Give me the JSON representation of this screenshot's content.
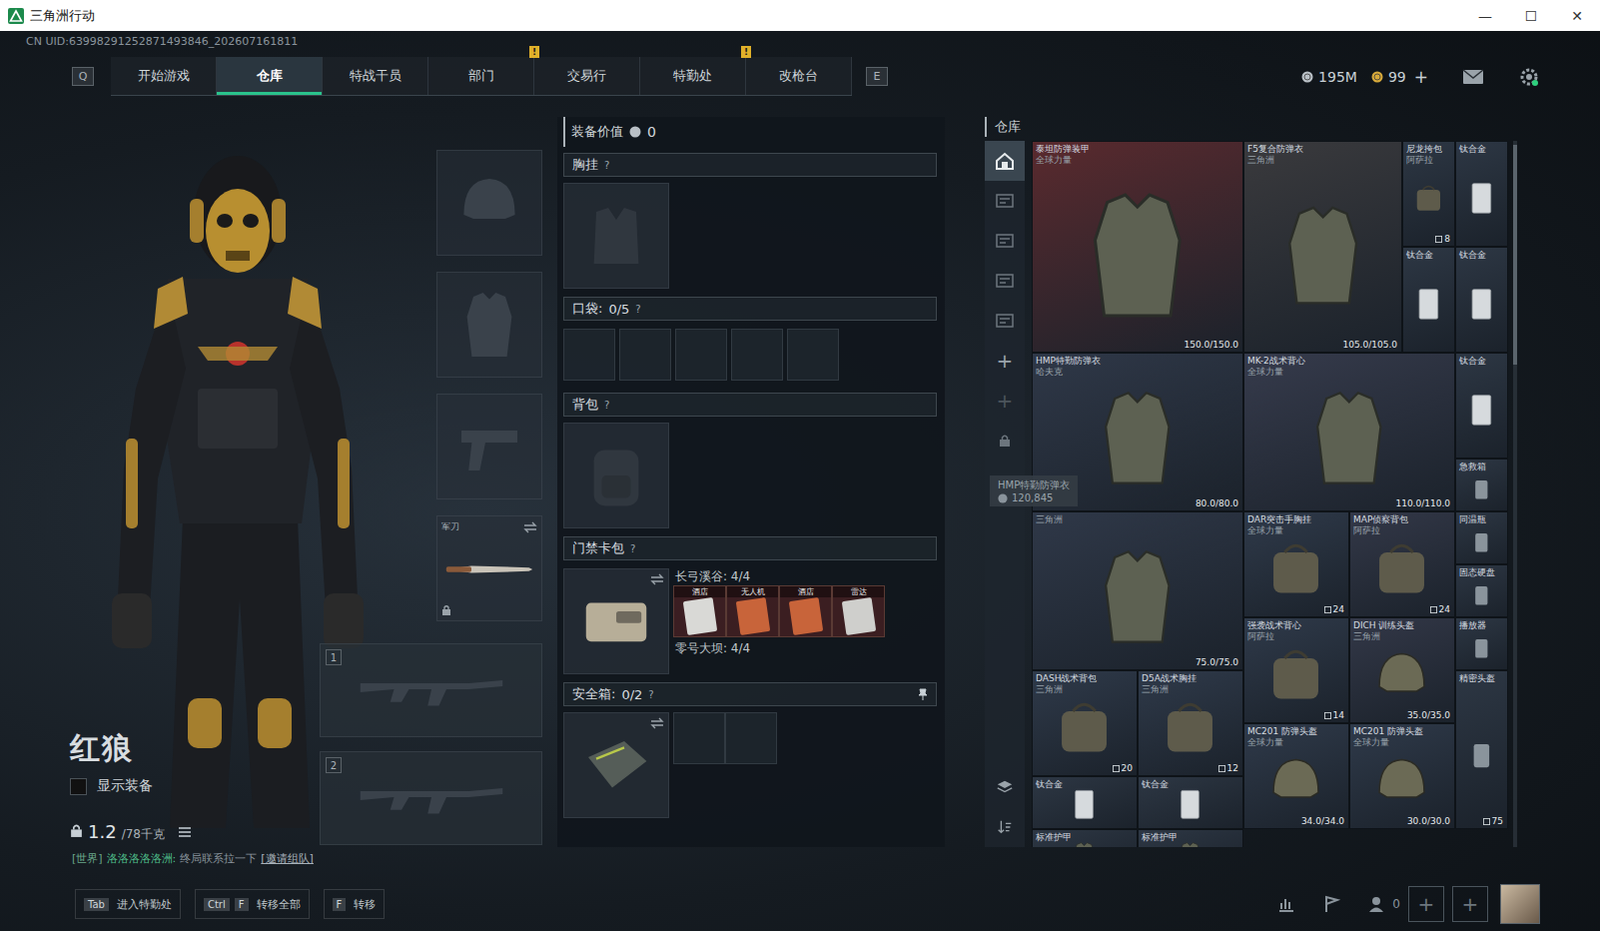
{
  "window": {
    "title": "三角洲行动",
    "controls": [
      "—",
      "☐",
      "✕"
    ]
  },
  "uid": "CN UID:63998291252871493846_202607161811",
  "nav": {
    "left_key": "Q",
    "right_key": "E",
    "alert_glyph": "!",
    "tabs": [
      {
        "label": "开始游戏",
        "selected": false,
        "alert": false
      },
      {
        "label": "仓库",
        "selected": true,
        "alert": false
      },
      {
        "label": "特战干员",
        "selected": false,
        "alert": false
      },
      {
        "label": "部门",
        "selected": false,
        "alert": false
      },
      {
        "label": "交易行",
        "selected": false,
        "alert": true
      },
      {
        "label": "特勤处",
        "selected": false,
        "alert": false
      },
      {
        "label": "改枪台",
        "selected": false,
        "alert": true
      }
    ]
  },
  "currency": {
    "items": [
      {
        "amount": "195M",
        "kind": "silver"
      },
      {
        "amount": "99",
        "kind": "gold"
      }
    ],
    "add": "+"
  },
  "character": {
    "name": "红狼",
    "show_gear": {
      "label": "显示装备",
      "checked": false
    },
    "weight": "1.2",
    "weight_max": "/78千克"
  },
  "chat": {
    "channel": "[世界]",
    "sender": "洛洛洛洛洛洲:",
    "message": "终局联系拉一下",
    "link": "[邀请组队]"
  },
  "slots": {
    "melee_label": "军刀",
    "weapon_slots": [
      "1",
      "2"
    ]
  },
  "loadout": {
    "value_label": "装备价值",
    "value": "0",
    "help": "?",
    "chest": {
      "label": "胸挂"
    },
    "pocket": {
      "label": "口袋:",
      "count": "0/5",
      "slots": 5
    },
    "backpack": {
      "label": "背包"
    },
    "keycard": {
      "label": "门禁卡包",
      "maps": [
        {
          "name": "长弓溪谷: 4/4",
          "cards": [
            {
              "label": "酒店",
              "color": "#d9d9d6"
            },
            {
              "label": "无人机",
              "color": "#c8643a"
            },
            {
              "label": "酒店",
              "color": "#c8643a"
            },
            {
              "label": "雷达",
              "color": "#cfcfcc"
            }
          ]
        },
        {
          "name": "零号大坝: 4/4",
          "cards": []
        }
      ]
    },
    "safebox": {
      "label": "安全箱:",
      "count": "0/2",
      "slots": 2
    }
  },
  "warehouse": {
    "title": "仓库",
    "sidebar": {
      "tabs": [
        {
          "selected": true
        },
        {
          "selected": false
        },
        {
          "selected": false
        },
        {
          "selected": false
        },
        {
          "selected": false
        }
      ],
      "add": [
        {
          "glyph": "+",
          "disabled": false
        },
        {
          "glyph": "+",
          "disabled": true
        }
      ]
    },
    "tooltip": {
      "name": "HMP特勤防弹衣",
      "value": "120,845"
    },
    "items": [
      {
        "name": "泰坦防弹装甲",
        "brand": "全球力量",
        "kind": "armor",
        "stat": "150.0/150.0",
        "count": "",
        "color": "#5a2a2e"
      },
      {
        "name": "F5复合防弹衣",
        "brand": "三角洲",
        "kind": "armor",
        "stat": "105.0/105.0",
        "count": "",
        "color": "#3a3a3d"
      },
      {
        "name": "尼龙挎包",
        "brand": "阿萨拉",
        "kind": "bag",
        "stat": "",
        "count": "8",
        "color": "#2d3744"
      },
      {
        "name": "钛合金",
        "brand": "",
        "kind": "plate",
        "stat": "",
        "count": "",
        "color": "#2d3744"
      },
      {
        "name": "钛合金",
        "brand": "",
        "kind": "plate",
        "stat": "",
        "count": "",
        "color": "#2d3744"
      },
      {
        "name": "钛合金",
        "brand": "",
        "kind": "plate",
        "stat": "",
        "count": "",
        "color": "#2d3744"
      },
      {
        "name": "HMP特勤防弹衣",
        "brand": "哈夫克",
        "kind": "armor",
        "stat": "80.0/80.0",
        "count": "",
        "color": "#2f3848"
      },
      {
        "name": "MK-2战术背心",
        "brand": "全球力量",
        "kind": "armor",
        "stat": "110.0/110.0",
        "count": "",
        "color": "#363b4c"
      },
      {
        "name": "钛合金",
        "brand": "",
        "kind": "plate",
        "stat": "",
        "count": "",
        "color": "#2d3744"
      },
      {
        "name": "急救箱",
        "brand": "",
        "kind": "misc",
        "stat": "",
        "count": "",
        "color": "#2d3744"
      },
      {
        "name": "",
        "brand": "三角洲",
        "kind": "armor",
        "stat": "75.0/75.0",
        "count": "",
        "color": "#2f3848"
      },
      {
        "name": "DAR突击手胸挂",
        "brand": "全球力量",
        "kind": "bag",
        "stat": "",
        "count": "24",
        "color": "#2f3a4a"
      },
      {
        "name": "MAP侦察背包",
        "brand": "阿萨拉",
        "kind": "bag",
        "stat": "",
        "count": "24",
        "color": "#333848"
      },
      {
        "name": "同温瓶",
        "brand": "",
        "kind": "misc",
        "stat": "",
        "count": "",
        "color": "#2d3744"
      },
      {
        "name": "固态硬盘",
        "brand": "",
        "kind": "misc",
        "stat": "",
        "count": "",
        "color": "#2d3744"
      },
      {
        "name": "强袭战术背心",
        "brand": "阿萨拉",
        "kind": "bag",
        "stat": "",
        "count": "14",
        "color": "#2f3a4a"
      },
      {
        "name": "DICH 训练头盔",
        "brand": "三角洲",
        "kind": "helmet",
        "stat": "35.0/35.0",
        "count": "",
        "color": "#333848"
      },
      {
        "name": "播放器",
        "brand": "",
        "kind": "misc",
        "stat": "",
        "count": "",
        "color": "#2d3744"
      },
      {
        "name": "DASH战术背包",
        "brand": "三角洲",
        "kind": "bag",
        "stat": "",
        "count": "20",
        "color": "#2f3a4a"
      },
      {
        "name": "D5A战术胸挂",
        "brand": "三角洲",
        "kind": "bag",
        "stat": "",
        "count": "12",
        "color": "#2f3a4a"
      },
      {
        "name": "精密头盔",
        "brand": "",
        "kind": "misc",
        "stat": "",
        "count": "75",
        "color": "#2d3744"
      },
      {
        "name": "MC201 防弹头盔",
        "brand": "全球力量",
        "kind": "helmet",
        "stat": "34.0/34.0",
        "count": "",
        "color": "#2f3a4a"
      },
      {
        "name": "MC201 防弹头盔",
        "brand": "全球力量",
        "kind": "helmet",
        "stat": "30.0/30.0",
        "count": "",
        "color": "#2f3a4a"
      },
      {
        "name": "钛合金",
        "brand": "",
        "kind": "plate",
        "stat": "",
        "count": "",
        "color": "#2d3744"
      },
      {
        "name": "钛合金",
        "brand": "",
        "kind": "plate",
        "stat": "",
        "count": "",
        "color": "#2d3744"
      },
      {
        "name": "标准护甲",
        "brand": "",
        "kind": "armor",
        "stat": "",
        "count": "",
        "color": "#2d3744"
      },
      {
        "name": "标准护甲",
        "brand": "",
        "kind": "armor",
        "stat": "",
        "count": "",
        "color": "#2d3744"
      }
    ]
  },
  "bottom": {
    "hints": [
      {
        "keys": [
          "Tab"
        ],
        "label": "进入特勤处"
      },
      {
        "keys": [
          "Ctrl",
          "F"
        ],
        "label": "转移全部"
      },
      {
        "keys": [
          "F"
        ],
        "label": "转移"
      }
    ],
    "friends": "0",
    "party_add": [
      "+",
      "+"
    ]
  }
}
